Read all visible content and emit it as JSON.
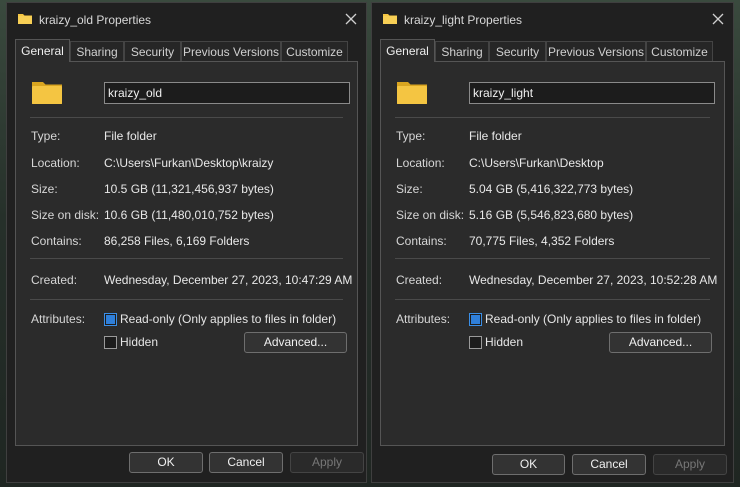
{
  "left_dialog": {
    "title": "kraizy_old Properties",
    "tabs": [
      {
        "label": "General",
        "active": true
      },
      {
        "label": "Sharing",
        "active": false
      },
      {
        "label": "Security",
        "active": false
      },
      {
        "label": "Previous Versions",
        "active": false
      },
      {
        "label": "Customize",
        "active": false
      }
    ],
    "name_value": "kraizy_old",
    "type_label": "Type:",
    "type_value": "File folder",
    "location_label": "Location:",
    "location_value": "C:\\Users\\Furkan\\Desktop\\kraizy",
    "size_label": "Size:",
    "size_value": "10.5 GB (11,321,456,937 bytes)",
    "size_on_disk_label": "Size on disk:",
    "size_on_disk_value": "10.6 GB (11,480,010,752 bytes)",
    "contains_label": "Contains:",
    "contains_value": "86,258 Files, 6,169 Folders",
    "created_label": "Created:",
    "created_value": "Wednesday, December 27, 2023, 10:47:29 AM",
    "attributes_label": "Attributes:",
    "readonly_label": "Read-only (Only applies to files in folder)",
    "hidden_label": "Hidden",
    "advanced_label": "Advanced...",
    "ok_label": "OK",
    "cancel_label": "Cancel",
    "apply_label": "Apply"
  },
  "right_dialog": {
    "title": "kraizy_light Properties",
    "tabs": [
      {
        "label": "General",
        "active": true
      },
      {
        "label": "Sharing",
        "active": false
      },
      {
        "label": "Security",
        "active": false
      },
      {
        "label": "Previous Versions",
        "active": false
      },
      {
        "label": "Customize",
        "active": false
      }
    ],
    "name_value": "kraizy_light",
    "type_label": "Type:",
    "type_value": "File folder",
    "location_label": "Location:",
    "location_value": "C:\\Users\\Furkan\\Desktop",
    "size_label": "Size:",
    "size_value": "5.04 GB (5,416,322,773 bytes)",
    "size_on_disk_label": "Size on disk:",
    "size_on_disk_value": "5.16 GB (5,546,823,680 bytes)",
    "contains_label": "Contains:",
    "contains_value": "70,775 Files, 4,352 Folders",
    "created_label": "Created:",
    "created_value": "Wednesday, December 27, 2023, 10:52:28 AM",
    "attributes_label": "Attributes:",
    "readonly_label": "Read-only (Only applies to files in folder)",
    "hidden_label": "Hidden",
    "advanced_label": "Advanced...",
    "ok_label": "OK",
    "cancel_label": "Cancel",
    "apply_label": "Apply"
  },
  "colors": {
    "folder_yellow": "#f4c542",
    "folder_dark": "#d9a520",
    "checkbox_accent": "#2f7fd9",
    "dialog_bg": "#202020",
    "panel_bg": "#2b2b2b"
  },
  "icons": {
    "title": "folder-icon",
    "close": "close-icon",
    "large": "folder-large-icon"
  }
}
